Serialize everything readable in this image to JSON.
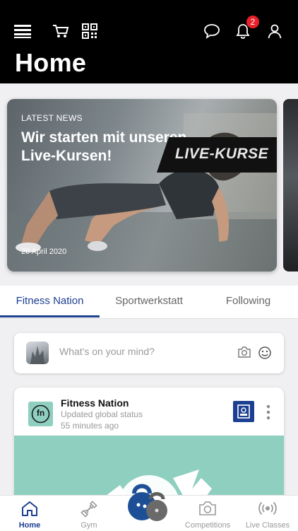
{
  "header": {
    "title": "Home",
    "notification_count": "2",
    "icons": [
      "menu-icon",
      "cart-icon",
      "qr-code-icon",
      "chat-icon",
      "bell-icon",
      "profile-icon"
    ]
  },
  "news": {
    "kicker": "LATEST NEWS",
    "headline": "Wir starten mit unseren Live-Kursen!",
    "date": "20 April 2020",
    "banner_text": "LIVE-KURSE"
  },
  "tabs": [
    {
      "label": "Fitness Nation",
      "active": true
    },
    {
      "label": "Sportwerkstatt",
      "active": false
    },
    {
      "label": "Following",
      "active": false
    }
  ],
  "composer": {
    "placeholder": "What's on your mind?",
    "icons": [
      "camera-icon",
      "emoji-icon"
    ]
  },
  "post": {
    "author": "Fitness Nation",
    "avatar_text": "fn",
    "status": "Updated global status",
    "time": "55 minutes ago"
  },
  "bottom_nav": [
    {
      "label": "Home",
      "icon": "home-icon",
      "active": true
    },
    {
      "label": "Gym",
      "icon": "dumbbell-icon",
      "active": false
    },
    {
      "label": "Competitions",
      "icon": "camera-icon",
      "active": false
    },
    {
      "label": "Live Classes",
      "icon": "broadcast-icon",
      "active": false
    }
  ],
  "colors": {
    "header_bg": "#000000",
    "accent": "#1c3f91",
    "badge": "#e8202a",
    "brand_teal": "#8ecfbf"
  }
}
